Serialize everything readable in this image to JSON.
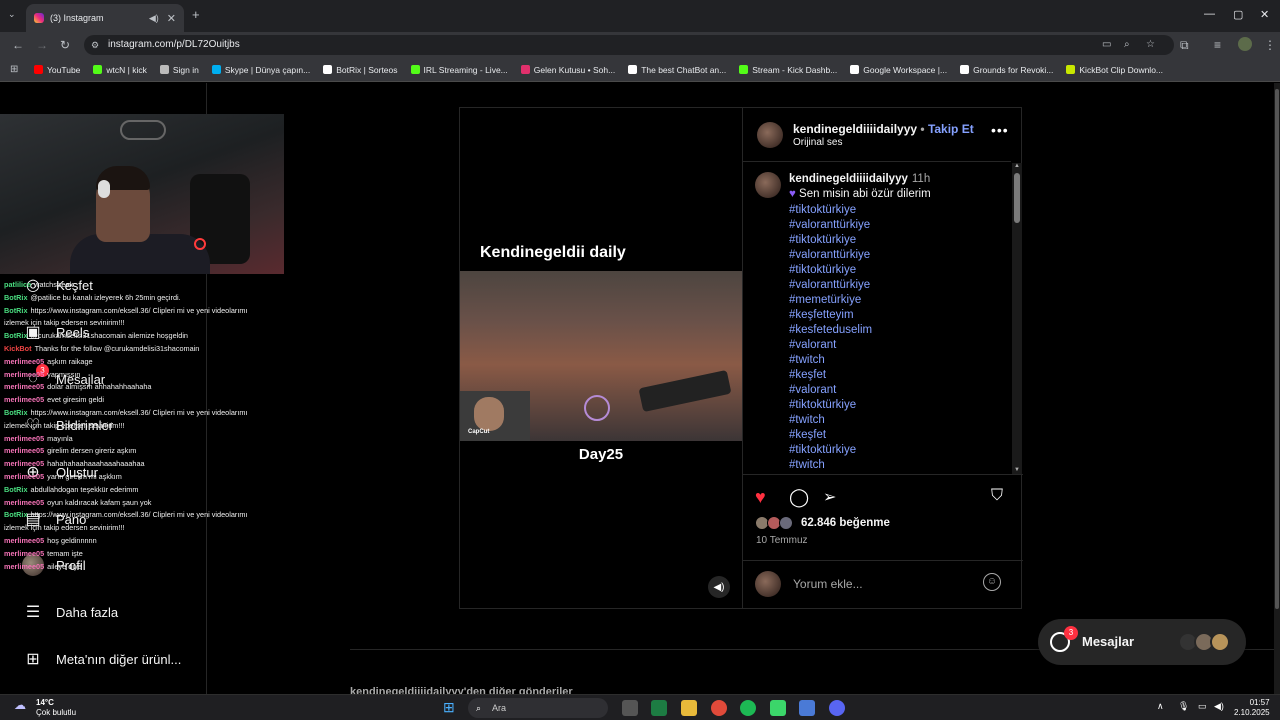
{
  "browser": {
    "tab_title": "(3) Instagram",
    "url": "instagram.com/p/DL72Ouitjbs",
    "bookmarks": [
      {
        "label": "YouTube",
        "color": "#ff0000"
      },
      {
        "label": "wtcN | kick",
        "color": "#53fc18"
      },
      {
        "label": "Sign in",
        "color": "#bbbbbb"
      },
      {
        "label": "Skype | Dünya çapın...",
        "color": "#00aff0"
      },
      {
        "label": "BotRix | Sorteos",
        "color": "#ffffff"
      },
      {
        "label": "IRL Streaming - Live...",
        "color": "#53fc18"
      },
      {
        "label": "Gelen Kutusu • Soh...",
        "color": "#e1306c"
      },
      {
        "label": "The best ChatBot an...",
        "color": "#ffffff"
      },
      {
        "label": "Stream - Kick Dashb...",
        "color": "#53fc18"
      },
      {
        "label": "Google Workspace |...",
        "color": "#ffffff"
      },
      {
        "label": "Grounds for Revoki...",
        "color": "#ffffff"
      },
      {
        "label": "KickBot Clip Downlo...",
        "color": "#c8e800"
      }
    ]
  },
  "sidebar": {
    "items": [
      {
        "label": "Keşfet",
        "icon": "compass-icon"
      },
      {
        "label": "Reels",
        "icon": "reels-icon"
      },
      {
        "label": "Mesajlar",
        "icon": "messenger-icon",
        "badge": "3"
      },
      {
        "label": "Bildirimler",
        "icon": "heart-icon"
      },
      {
        "label": "Oluştur",
        "icon": "plus-square-icon"
      },
      {
        "label": "Pano",
        "icon": "dashboard-icon"
      },
      {
        "label": "Profil",
        "icon": "avatar"
      },
      {
        "label": "Daha fazla",
        "icon": "menu-icon"
      },
      {
        "label": "Meta'nın diğer ürünl...",
        "icon": "grid-icon"
      }
    ]
  },
  "chat": {
    "lines": [
      {
        "user": "patlilice",
        "msg": "watchstreak",
        "color": "#4ade80"
      },
      {
        "user": "BotRix",
        "msg": "@patilice bu kanalı izleyerek 6h 25min geçirdi.",
        "color": "#4ade80"
      },
      {
        "user": "BotRix",
        "msg": "https://www.instagram.com/eksell.36/ Clipleri mi ve yeni videolarımı",
        "color": "#4ade80"
      },
      {
        "user": "",
        "msg": "izlemek için takip edersen sevinirim!!!",
        "color": "#4ade80"
      },
      {
        "user": "BotRix",
        "msg": "@curukamdelisi31shacomain ailemize hoşgeldin",
        "color": "#4ade80"
      },
      {
        "user": "KickBot",
        "msg": "Thanks for the follow @curukamdelisi31shacomain",
        "color": "#ef4444"
      },
      {
        "user": "merlimee05",
        "msg": "aşkım raikage",
        "color": "#f472b6"
      },
      {
        "user": "merlimee05",
        "msg": "yapmışsın",
        "color": "#f472b6"
      },
      {
        "user": "merlimee05",
        "msg": "dolar almışsın ahhahahhaahaha",
        "color": "#f472b6"
      },
      {
        "user": "merlimee05",
        "msg": "evet giresim geldi",
        "color": "#f472b6"
      },
      {
        "user": "BotRix",
        "msg": "https://www.instagram.com/eksell.36/ Clipleri mi ve yeni videolarımı",
        "color": "#4ade80"
      },
      {
        "user": "",
        "msg": "izlemek için takip edersen sevinirim!!!",
        "color": "#4ade80"
      },
      {
        "user": "merlimee05",
        "msg": "mayınla",
        "color": "#f472b6"
      },
      {
        "user": "merlimee05",
        "msg": "girelim dersen gireriz aşkım",
        "color": "#f472b6"
      },
      {
        "user": "merlimee05",
        "msg": "hahahahaahaaahaaahaaahaa",
        "color": "#f472b6"
      },
      {
        "user": "merlimee05",
        "msg": "yarın girelim mi aşkkım",
        "color": "#f472b6"
      },
      {
        "user": "BotRix",
        "msg": "abdullahdogan teşekkür ederimm",
        "color": "#4ade80"
      },
      {
        "user": "merlimee05",
        "msg": "oyun kaldıracak kafam şaun yok",
        "color": "#f472b6"
      },
      {
        "user": "BotRix",
        "msg": "https://www.instagram.com/eksell.36/ Clipleri mi ve yeni videolarımı",
        "color": "#4ade80"
      },
      {
        "user": "",
        "msg": "izlemek için takip edersen sevinirim!!!",
        "color": "#4ade80"
      },
      {
        "user": "merlimee05",
        "msg": "hoş geldinnnnn",
        "color": "#f472b6"
      },
      {
        "user": "merlimee05",
        "msg": "temam işte",
        "color": "#f472b6"
      },
      {
        "user": "merlimee05",
        "msg": "aileye diye",
        "color": "#f472b6"
      }
    ]
  },
  "post": {
    "media_title": "Kendinegeldii daily",
    "media_subtitle": "Day25",
    "video_watermark": "CapCut",
    "username": "kendinegeldiiiidailyyy",
    "separator": "•",
    "follow_label": "Takip Et",
    "audio": "Orijinal ses",
    "caption_time": "11h",
    "caption_text": "Sen misin abi özür dilerim",
    "hashtags": [
      "#tiktoktürkiye",
      "#valoranttürkiye",
      "#tiktoktürkiye",
      "#valoranttürkiye",
      "#tiktoktürkiye",
      "#valoranttürkiye",
      "#memetürkiye",
      "#keşfetteyim",
      "#kesfeteduselim",
      "#valorant",
      "#twitch",
      "#keşfet",
      "#valorant",
      "#tiktoktürkiye",
      "#twitch",
      "#keşfet",
      "#tiktoktürkiye",
      "#twitch"
    ],
    "likes": "62.846 beğenme",
    "date": "10 Temmuz",
    "comment_placeholder": "Yorum ekle...",
    "liked": true
  },
  "more_from": "kendinegeldiiiidailyyy'den diğer gönderiler",
  "messages_pill": {
    "label": "Mesajlar",
    "badge": "3"
  },
  "taskbar": {
    "temp": "14°C",
    "weather": "Çok bulutlu",
    "search_placeholder": "Ara",
    "time": "01:57",
    "date": "2.10.2025"
  }
}
